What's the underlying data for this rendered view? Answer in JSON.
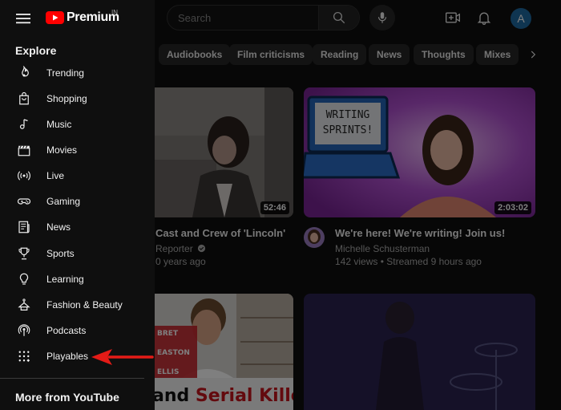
{
  "header": {
    "logo_text": "Premium",
    "region": "IN",
    "search_placeholder": "Search",
    "avatar_letter": "A"
  },
  "chips": [
    {
      "label": "Audiobooks"
    },
    {
      "label": "Film criticisms"
    },
    {
      "label": "Reading"
    },
    {
      "label": "News"
    },
    {
      "label": "Thoughts"
    },
    {
      "label": "Mixes"
    }
  ],
  "videos": [
    {
      "title": "Cast and Crew of 'Lincoln'",
      "channel": "Reporter",
      "meta": "0 years ago",
      "duration": "52:46"
    },
    {
      "title": "We're here! We're writing! Join us!",
      "channel": "Michelle Schusterman",
      "meta": "142 views • Streamed 9 hours ago",
      "duration": "2:03:02",
      "thumb_sign": [
        "WRITING",
        "SPRINTS!"
      ]
    },
    {
      "thumb_names": [
        "BRET",
        "EASTON",
        "ELLIS"
      ],
      "thumb_caption_a": "and ",
      "thumb_caption_b": "Serial Killers"
    }
  ],
  "drawer": {
    "explore_title": "Explore",
    "items": [
      {
        "label": "Trending",
        "icon": "trending-icon"
      },
      {
        "label": "Shopping",
        "icon": "shopping-icon"
      },
      {
        "label": "Music",
        "icon": "music-icon"
      },
      {
        "label": "Movies",
        "icon": "movies-icon"
      },
      {
        "label": "Live",
        "icon": "live-icon"
      },
      {
        "label": "Gaming",
        "icon": "gaming-icon"
      },
      {
        "label": "News",
        "icon": "news-icon"
      },
      {
        "label": "Sports",
        "icon": "sports-icon"
      },
      {
        "label": "Learning",
        "icon": "learning-icon"
      },
      {
        "label": "Fashion & Beauty",
        "icon": "fashion-icon"
      },
      {
        "label": "Podcasts",
        "icon": "podcasts-icon"
      },
      {
        "label": "Playables",
        "icon": "playables-icon"
      }
    ],
    "more_title": "More from YouTube"
  },
  "colors": {
    "brand_red": "#ff0000",
    "annotation_arrow": "#e41b17",
    "avatar_bg": "#1e6aa3"
  }
}
